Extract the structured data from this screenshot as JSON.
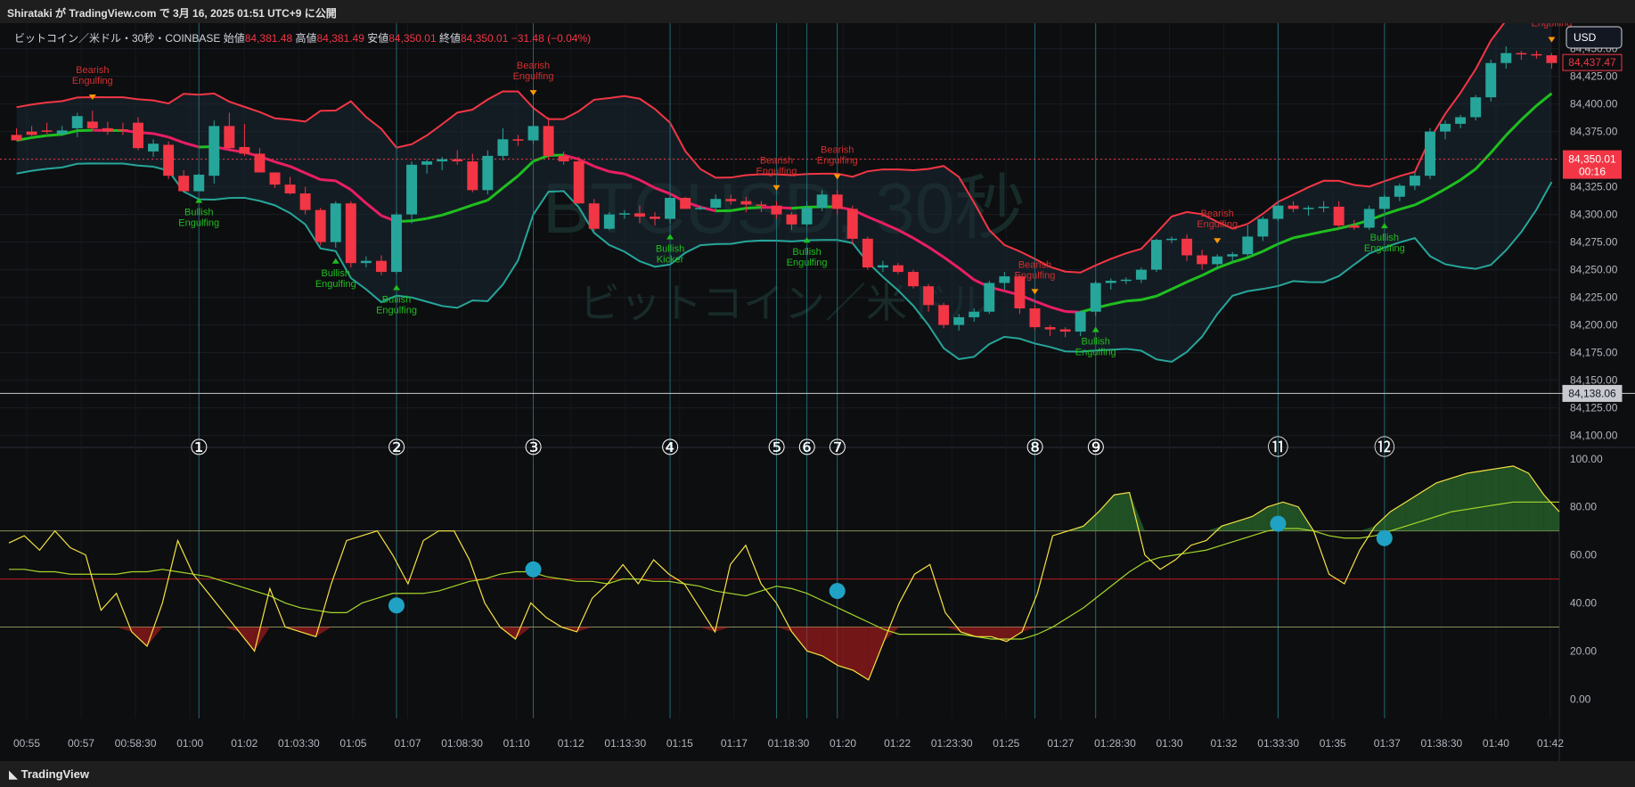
{
  "top_bar": {
    "text": "Shirataki が TradingView.com で 3月 16, 2025 01:51 UTC+9 に公開"
  },
  "header": {
    "symbol": "ビットコイン／米ドル・30秒・COINBASE",
    "open_label": "始値",
    "open": "84,381.48",
    "high_label": "高値",
    "high": "84,381.49",
    "low_label": "安値",
    "low": "84,350.01",
    "close_label": "終値",
    "close": "84,350.01",
    "change": "−31.48 (−0.04%)"
  },
  "watermark": {
    "main": "BTCUSD, 30秒",
    "sub": "ビットコイン／米ドル"
  },
  "currency": "USD",
  "price_tags": {
    "last": "84,437.47",
    "current": "84,350.01",
    "countdown": "00:16",
    "hline": "84,138.06"
  },
  "bottom_bar": {
    "logo": "TradingView"
  },
  "colors": {
    "up": "#26a69a",
    "down": "#f23645",
    "upper_band": "#f23645",
    "lower_band": "#26a69a",
    "mid_green": "#1fbf1f",
    "mid_pink": "#e91e63",
    "rsi": "#f5e342",
    "rsi_ma": "#a5d62a"
  },
  "chart_data": {
    "type": "candlestick",
    "price_axis": {
      "ticks": [
        "84,450.00",
        "84,425.00",
        "84,400.00",
        "84,375.00",
        "84,350.00",
        "84,325.00",
        "84,300.00",
        "84,275.00",
        "84,250.00",
        "84,225.00",
        "84,200.00",
        "84,175.00",
        "84,150.00",
        "84,125.00",
        "84,100.00"
      ],
      "range": [
        84090,
        84465
      ]
    },
    "time_axis": {
      "ticks": [
        "00:55",
        "00:57",
        "00:58:30",
        "01:00",
        "01:02",
        "01:03:30",
        "01:05",
        "01:07",
        "01:08:30",
        "01:10",
        "01:12",
        "01:13:30",
        "01:15",
        "01:17",
        "01:18:30",
        "01:20",
        "01:22",
        "01:23:30",
        "01:25",
        "01:27",
        "01:28:30",
        "01:30",
        "01:32",
        "01:33:30",
        "01:35",
        "01:37",
        "01:38:30",
        "01:40",
        "01:42"
      ]
    },
    "candles": [
      [
        84372,
        84378,
        84368,
        84367
      ],
      [
        84375,
        84380,
        84370,
        84372
      ],
      [
        84376,
        84383,
        84373,
        84375
      ],
      [
        84373,
        84380,
        84371,
        84376
      ],
      [
        84378,
        84392,
        84370,
        84389
      ],
      [
        84384,
        84394,
        84377,
        84378
      ],
      [
        84378,
        84384,
        84372,
        84375
      ],
      [
        84377,
        84383,
        84372,
        84376
      ],
      [
        84383,
        84388,
        84358,
        84360
      ],
      [
        84357,
        84368,
        84352,
        84364
      ],
      [
        84363,
        84366,
        84332,
        84335
      ],
      [
        84335,
        84340,
        84325,
        84321
      ],
      [
        84321,
        84337,
        84325,
        84336
      ],
      [
        84335,
        84385,
        84328,
        84380
      ],
      [
        84380,
        84392,
        84358,
        84360
      ],
      [
        84361,
        84382,
        84353,
        84355
      ],
      [
        84355,
        84360,
        84341,
        84338
      ],
      [
        84338,
        84335,
        84324,
        84327
      ],
      [
        84327,
        84334,
        84318,
        84319
      ],
      [
        84319,
        84325,
        84300,
        84304
      ],
      [
        84304,
        84306,
        84272,
        84275
      ],
      [
        84275,
        84312,
        84270,
        84310
      ],
      [
        84310,
        84312,
        84252,
        84256
      ],
      [
        84256,
        84262,
        84252,
        84258
      ],
      [
        84258,
        84263,
        84245,
        84248
      ],
      [
        84248,
        84302,
        84246,
        84300
      ],
      [
        84300,
        84348,
        84292,
        84345
      ],
      [
        84345,
        84350,
        84337,
        84348
      ],
      [
        84348,
        84352,
        84340,
        84350
      ],
      [
        84350,
        84358,
        84345,
        84348
      ],
      [
        84348,
        84355,
        84320,
        84322
      ],
      [
        84322,
        84358,
        84318,
        84353
      ],
      [
        84353,
        84378,
        84349,
        84368
      ],
      [
        84368,
        84372,
        84362,
        84367
      ],
      [
        84367,
        84398,
        84364,
        84380
      ],
      [
        84380,
        84388,
        84350,
        84353
      ],
      [
        84353,
        84357,
        84345,
        84348
      ],
      [
        84348,
        84352,
        84310,
        84310
      ],
      [
        84310,
        84314,
        84285,
        84287
      ],
      [
        84287,
        84302,
        84286,
        84300
      ],
      [
        84300,
        84304,
        84296,
        84301
      ],
      [
        84301,
        84308,
        84292,
        84298
      ],
      [
        84298,
        84302,
        84290,
        84296
      ],
      [
        84296,
        84318,
        84292,
        84315
      ],
      [
        84315,
        84316,
        84305,
        84305
      ],
      [
        84305,
        84308,
        84304,
        84306
      ],
      [
        84306,
        84318,
        84304,
        84314
      ],
      [
        84314,
        84318,
        84309,
        84312
      ],
      [
        84312,
        84316,
        84302,
        84309
      ],
      [
        84309,
        84312,
        84302,
        84308
      ],
      [
        84308,
        84312,
        84296,
        84300
      ],
      [
        84300,
        84302,
        84286,
        84291
      ],
      [
        84291,
        84312,
        84289,
        84306
      ],
      [
        84306,
        84322,
        84303,
        84318
      ],
      [
        84318,
        84322,
        84300,
        84305
      ],
      [
        84305,
        84308,
        84273,
        84278
      ],
      [
        84278,
        84280,
        84250,
        84252
      ],
      [
        84252,
        84258,
        84248,
        84254
      ],
      [
        84254,
        84256,
        84246,
        84248
      ],
      [
        84248,
        84250,
        84233,
        84235
      ],
      [
        84235,
        84237,
        84212,
        84218
      ],
      [
        84218,
        84220,
        84197,
        84200
      ],
      [
        84200,
        84210,
        84195,
        84207
      ],
      [
        84207,
        84215,
        84203,
        84212
      ],
      [
        84212,
        84240,
        84210,
        84238
      ],
      [
        84238,
        84248,
        84232,
        84244
      ],
      [
        84244,
        84245,
        84210,
        84215
      ],
      [
        84215,
        84218,
        84196,
        84198
      ],
      [
        84198,
        84200,
        84190,
        84196
      ],
      [
        84196,
        84198,
        84189,
        84194
      ],
      [
        84194,
        84213,
        84190,
        84212
      ],
      [
        84212,
        84240,
        84208,
        84238
      ],
      [
        84238,
        84242,
        84232,
        84240
      ],
      [
        84240,
        84243,
        84237,
        84241
      ],
      [
        84241,
        84252,
        84238,
        84250
      ],
      [
        84250,
        84278,
        84248,
        84277
      ],
      [
        84277,
        84280,
        84274,
        84278
      ],
      [
        84278,
        84282,
        84258,
        84263
      ],
      [
        84263,
        84268,
        84250,
        84255
      ],
      [
        84255,
        84264,
        84250,
        84262
      ],
      [
        84262,
        84266,
        84258,
        84264
      ],
      [
        84264,
        84290,
        84262,
        84280
      ],
      [
        84280,
        84298,
        84276,
        84296
      ],
      [
        84296,
        84310,
        84294,
        84308
      ],
      [
        84308,
        84312,
        84302,
        84305
      ],
      [
        84305,
        84308,
        84299,
        84306
      ],
      [
        84306,
        84312,
        84302,
        84307
      ],
      [
        84307,
        84312,
        84288,
        84290
      ],
      [
        84290,
        84295,
        84286,
        84288
      ],
      [
        84288,
        84308,
        84286,
        84305
      ],
      [
        84305,
        84318,
        84302,
        84316
      ],
      [
        84316,
        84328,
        84312,
        84326
      ],
      [
        84326,
        84338,
        84322,
        84335
      ],
      [
        84335,
        84378,
        84332,
        84375
      ],
      [
        84375,
        84385,
        84368,
        84382
      ],
      [
        84382,
        84390,
        84378,
        84388
      ],
      [
        84388,
        84408,
        84385,
        84406
      ],
      [
        84406,
        84440,
        84402,
        84437
      ],
      [
        84437,
        84452,
        84432,
        84446
      ],
      [
        84446,
        84448,
        84440,
        84445
      ],
      [
        84445,
        84448,
        84441,
        84444
      ],
      [
        84444,
        84446,
        84432,
        84437
      ]
    ],
    "signals": [
      {
        "label": "Bearish Engulfing",
        "index": 5,
        "pos": "above"
      },
      {
        "label": "Bullish Engulfing",
        "index": 12,
        "pos": "below"
      },
      {
        "label": "Bullish Engulfing",
        "index": 21,
        "pos": "below"
      },
      {
        "label": "Bullish Engulfing",
        "index": 25,
        "pos": "below"
      },
      {
        "label": "Bearish Engulfing",
        "index": 34,
        "pos": "above"
      },
      {
        "label": "Bullish Kicker",
        "index": 43,
        "pos": "below"
      },
      {
        "label": "Bearish Engulfing",
        "index": 50,
        "pos": "above"
      },
      {
        "label": "Bullish Engulfing",
        "index": 52,
        "pos": "below"
      },
      {
        "label": "Bearish Engulfing",
        "index": 54,
        "pos": "above"
      },
      {
        "label": "Bearish Engulfing",
        "index": 67,
        "pos": "above"
      },
      {
        "label": "Bullish Engulfing",
        "index": 71,
        "pos": "below"
      },
      {
        "label": "Bearish Engulfing",
        "index": 79,
        "pos": "above"
      },
      {
        "label": "Bullish Engulfing",
        "index": 90,
        "pos": "below"
      },
      {
        "label": "Bearish Engulfing",
        "index": 101,
        "pos": "above"
      }
    ],
    "markers": [
      {
        "label": "①",
        "index": 12
      },
      {
        "label": "②",
        "index": 25
      },
      {
        "label": "③",
        "index": 34
      },
      {
        "label": "④",
        "index": 43
      },
      {
        "label": "⑤",
        "index": 50
      },
      {
        "label": "⑥",
        "index": 52
      },
      {
        "label": "⑦",
        "index": 54
      },
      {
        "label": "⑧",
        "index": 67
      },
      {
        "label": "⑨",
        "index": 71
      },
      {
        "label": "⑪",
        "index": 83
      },
      {
        "label": "⑫",
        "index": 90
      }
    ],
    "hline": 84138.06,
    "current_price": 84350.01,
    "rsi_axis": {
      "ticks": [
        "100.00",
        "80.00",
        "60.00",
        "40.00",
        "20.00",
        "0.00"
      ],
      "range": [
        -8,
        104
      ],
      "levels": [
        70,
        50,
        30
      ]
    },
    "rsi": [
      65,
      68,
      62,
      70,
      63,
      60,
      37,
      44,
      28,
      22,
      40,
      66,
      52,
      44,
      36,
      28,
      20,
      46,
      30,
      28,
      26,
      48,
      66,
      68,
      70,
      60,
      48,
      66,
      70,
      70,
      58,
      40,
      30,
      25,
      40,
      34,
      30,
      28,
      42,
      48,
      56,
      48,
      58,
      52,
      48,
      38,
      28,
      56,
      64,
      48,
      40,
      28,
      20,
      18,
      14,
      12,
      8,
      24,
      40,
      52,
      56,
      36,
      28,
      26,
      26,
      24,
      28,
      44,
      68,
      70,
      72,
      78,
      85,
      86,
      60,
      54,
      58,
      64,
      66,
      72,
      74,
      76,
      80,
      82,
      80,
      70,
      52,
      48,
      62,
      72,
      78,
      82,
      86,
      90,
      92,
      94,
      95,
      96,
      97,
      94,
      85,
      78
    ],
    "rsi_ma": [
      54,
      54,
      53,
      53,
      52,
      52,
      52,
      52,
      53,
      53,
      54,
      53,
      52,
      51,
      49,
      47,
      45,
      43,
      40,
      38,
      37,
      36,
      36,
      40,
      42,
      44,
      44,
      44,
      45,
      47,
      49,
      50,
      52,
      53,
      53,
      51,
      50,
      49,
      49,
      48,
      50,
      50,
      49,
      49,
      48,
      47,
      45,
      44,
      43,
      45,
      47,
      46,
      44,
      41,
      38,
      35,
      32,
      29,
      27,
      27,
      27,
      27,
      27,
      26,
      25,
      25,
      25,
      27,
      30,
      34,
      38,
      43,
      48,
      53,
      57,
      59,
      60,
      61,
      62,
      64,
      66,
      68,
      70,
      71,
      71,
      70,
      68,
      67,
      67,
      68,
      70,
      72,
      74,
      76,
      78,
      79,
      80,
      81,
      82,
      82,
      82,
      82
    ]
  }
}
